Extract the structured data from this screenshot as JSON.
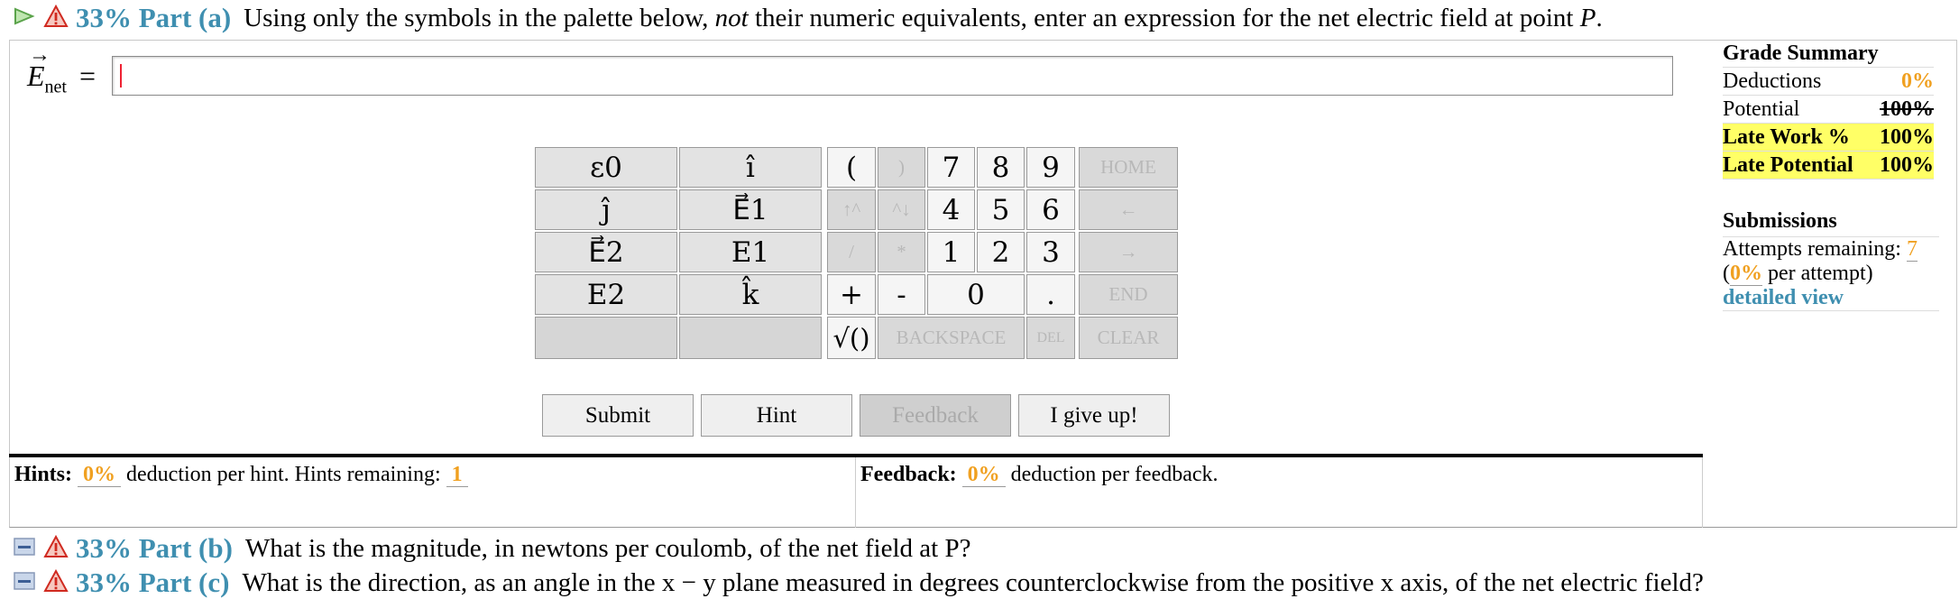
{
  "part_a": {
    "percent": "33% Part (a)",
    "question_pre": "Using only the symbols in the palette below, ",
    "question_em": "not",
    "question_post": " their numeric equivalents, enter an expression for the net electric field at point ",
    "question_var": "P",
    "question_end": "."
  },
  "answer": {
    "label_main": "E",
    "label_sub": "net",
    "equals": "=",
    "value": ""
  },
  "palette": {
    "symbols": [
      "ε0",
      "î",
      "ĵ",
      "E⃗1",
      "E⃗2",
      "E1",
      "E2",
      "k̂",
      "",
      ""
    ],
    "ops": [
      "(",
      ")",
      "↑^",
      "^↓",
      "/",
      "*",
      "+",
      "-",
      "√()",
      "BACKSPACE",
      "DEL"
    ],
    "digits": [
      "7",
      "8",
      "9",
      "4",
      "5",
      "6",
      "1",
      "2",
      "3",
      "0",
      "."
    ],
    "nav": [
      "HOME",
      "←",
      "→",
      "END",
      "CLEAR"
    ]
  },
  "buttons": {
    "submit": "Submit",
    "hint": "Hint",
    "feedback": "Feedback",
    "give_up": "I give up!"
  },
  "hints": {
    "label": "Hints:",
    "pct": "0%",
    "mid": "deduction per hint. Hints remaining:",
    "remaining": "1"
  },
  "feedback": {
    "label": "Feedback:",
    "pct": "0%",
    "text": "deduction per feedback."
  },
  "grade_summary": {
    "title": "Grade Summary",
    "deductions_label": "Deductions",
    "deductions_value": "0%",
    "potential_label": "Potential",
    "potential_value": "100%",
    "late_work_label": "Late Work %",
    "late_work_value": "100%",
    "late_potential_label": "Late Potential",
    "late_potential_value": "100%"
  },
  "submissions": {
    "title": "Submissions",
    "attempts_label": "Attempts remaining:",
    "attempts_value": "7",
    "per_attempt_pct": "0%",
    "per_attempt_text": "per attempt)",
    "detailed": "detailed view"
  },
  "part_b": {
    "percent": "33% Part (b)",
    "question": "What is the magnitude, in newtons per coulomb, of the net field at P?"
  },
  "part_c": {
    "percent": "33% Part (c)",
    "question": "What is the direction, as an angle in the x − y plane measured in degrees counterclockwise from the positive x axis, of the net electric field?"
  },
  "colors": {
    "accent": "#3f8fb0",
    "orange": "#f0a020",
    "highlight": "#ffff66",
    "warning": "#e03030"
  }
}
